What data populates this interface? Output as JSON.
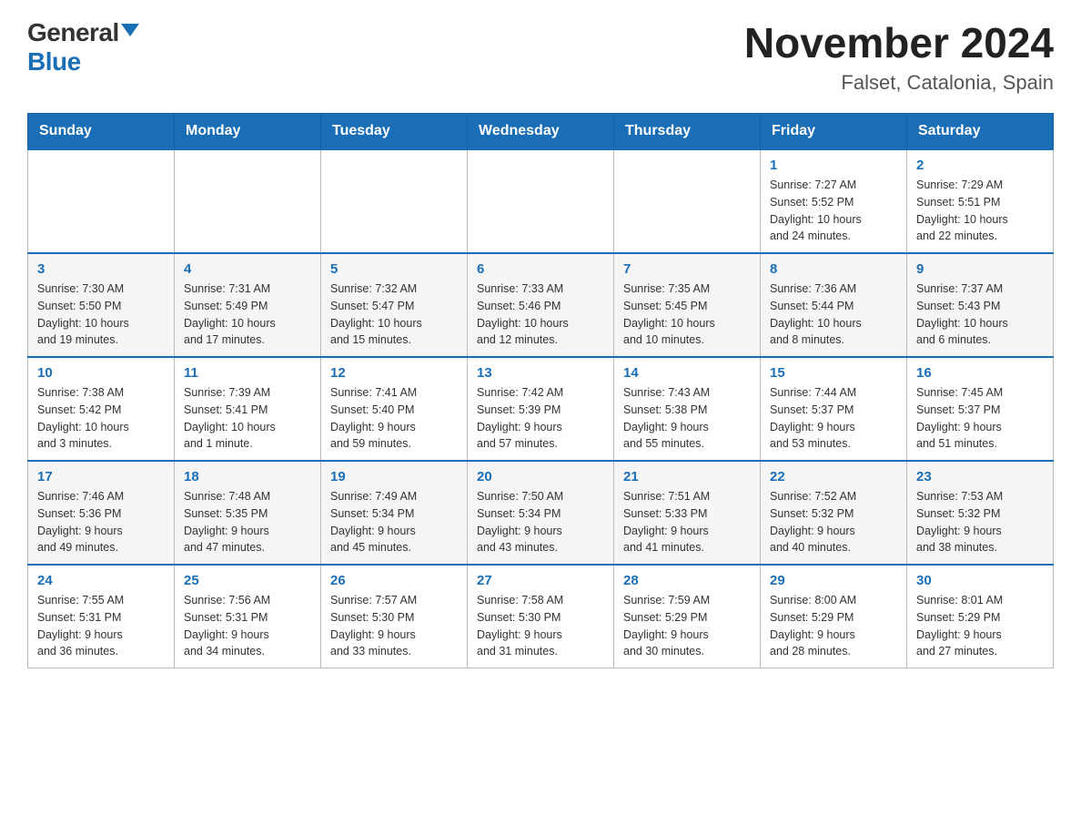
{
  "logo": {
    "general": "General",
    "blue": "Blue"
  },
  "title": "November 2024",
  "location": "Falset, Catalonia, Spain",
  "days_of_week": [
    "Sunday",
    "Monday",
    "Tuesday",
    "Wednesday",
    "Thursday",
    "Friday",
    "Saturday"
  ],
  "weeks": [
    {
      "days": [
        {
          "number": "",
          "info": ""
        },
        {
          "number": "",
          "info": ""
        },
        {
          "number": "",
          "info": ""
        },
        {
          "number": "",
          "info": ""
        },
        {
          "number": "",
          "info": ""
        },
        {
          "number": "1",
          "info": "Sunrise: 7:27 AM\nSunset: 5:52 PM\nDaylight: 10 hours\nand 24 minutes."
        },
        {
          "number": "2",
          "info": "Sunrise: 7:29 AM\nSunset: 5:51 PM\nDaylight: 10 hours\nand 22 minutes."
        }
      ]
    },
    {
      "days": [
        {
          "number": "3",
          "info": "Sunrise: 7:30 AM\nSunset: 5:50 PM\nDaylight: 10 hours\nand 19 minutes."
        },
        {
          "number": "4",
          "info": "Sunrise: 7:31 AM\nSunset: 5:49 PM\nDaylight: 10 hours\nand 17 minutes."
        },
        {
          "number": "5",
          "info": "Sunrise: 7:32 AM\nSunset: 5:47 PM\nDaylight: 10 hours\nand 15 minutes."
        },
        {
          "number": "6",
          "info": "Sunrise: 7:33 AM\nSunset: 5:46 PM\nDaylight: 10 hours\nand 12 minutes."
        },
        {
          "number": "7",
          "info": "Sunrise: 7:35 AM\nSunset: 5:45 PM\nDaylight: 10 hours\nand 10 minutes."
        },
        {
          "number": "8",
          "info": "Sunrise: 7:36 AM\nSunset: 5:44 PM\nDaylight: 10 hours\nand 8 minutes."
        },
        {
          "number": "9",
          "info": "Sunrise: 7:37 AM\nSunset: 5:43 PM\nDaylight: 10 hours\nand 6 minutes."
        }
      ]
    },
    {
      "days": [
        {
          "number": "10",
          "info": "Sunrise: 7:38 AM\nSunset: 5:42 PM\nDaylight: 10 hours\nand 3 minutes."
        },
        {
          "number": "11",
          "info": "Sunrise: 7:39 AM\nSunset: 5:41 PM\nDaylight: 10 hours\nand 1 minute."
        },
        {
          "number": "12",
          "info": "Sunrise: 7:41 AM\nSunset: 5:40 PM\nDaylight: 9 hours\nand 59 minutes."
        },
        {
          "number": "13",
          "info": "Sunrise: 7:42 AM\nSunset: 5:39 PM\nDaylight: 9 hours\nand 57 minutes."
        },
        {
          "number": "14",
          "info": "Sunrise: 7:43 AM\nSunset: 5:38 PM\nDaylight: 9 hours\nand 55 minutes."
        },
        {
          "number": "15",
          "info": "Sunrise: 7:44 AM\nSunset: 5:37 PM\nDaylight: 9 hours\nand 53 minutes."
        },
        {
          "number": "16",
          "info": "Sunrise: 7:45 AM\nSunset: 5:37 PM\nDaylight: 9 hours\nand 51 minutes."
        }
      ]
    },
    {
      "days": [
        {
          "number": "17",
          "info": "Sunrise: 7:46 AM\nSunset: 5:36 PM\nDaylight: 9 hours\nand 49 minutes."
        },
        {
          "number": "18",
          "info": "Sunrise: 7:48 AM\nSunset: 5:35 PM\nDaylight: 9 hours\nand 47 minutes."
        },
        {
          "number": "19",
          "info": "Sunrise: 7:49 AM\nSunset: 5:34 PM\nDaylight: 9 hours\nand 45 minutes."
        },
        {
          "number": "20",
          "info": "Sunrise: 7:50 AM\nSunset: 5:34 PM\nDaylight: 9 hours\nand 43 minutes."
        },
        {
          "number": "21",
          "info": "Sunrise: 7:51 AM\nSunset: 5:33 PM\nDaylight: 9 hours\nand 41 minutes."
        },
        {
          "number": "22",
          "info": "Sunrise: 7:52 AM\nSunset: 5:32 PM\nDaylight: 9 hours\nand 40 minutes."
        },
        {
          "number": "23",
          "info": "Sunrise: 7:53 AM\nSunset: 5:32 PM\nDaylight: 9 hours\nand 38 minutes."
        }
      ]
    },
    {
      "days": [
        {
          "number": "24",
          "info": "Sunrise: 7:55 AM\nSunset: 5:31 PM\nDaylight: 9 hours\nand 36 minutes."
        },
        {
          "number": "25",
          "info": "Sunrise: 7:56 AM\nSunset: 5:31 PM\nDaylight: 9 hours\nand 34 minutes."
        },
        {
          "number": "26",
          "info": "Sunrise: 7:57 AM\nSunset: 5:30 PM\nDaylight: 9 hours\nand 33 minutes."
        },
        {
          "number": "27",
          "info": "Sunrise: 7:58 AM\nSunset: 5:30 PM\nDaylight: 9 hours\nand 31 minutes."
        },
        {
          "number": "28",
          "info": "Sunrise: 7:59 AM\nSunset: 5:29 PM\nDaylight: 9 hours\nand 30 minutes."
        },
        {
          "number": "29",
          "info": "Sunrise: 8:00 AM\nSunset: 5:29 PM\nDaylight: 9 hours\nand 28 minutes."
        },
        {
          "number": "30",
          "info": "Sunrise: 8:01 AM\nSunset: 5:29 PM\nDaylight: 9 hours\nand 27 minutes."
        }
      ]
    }
  ]
}
